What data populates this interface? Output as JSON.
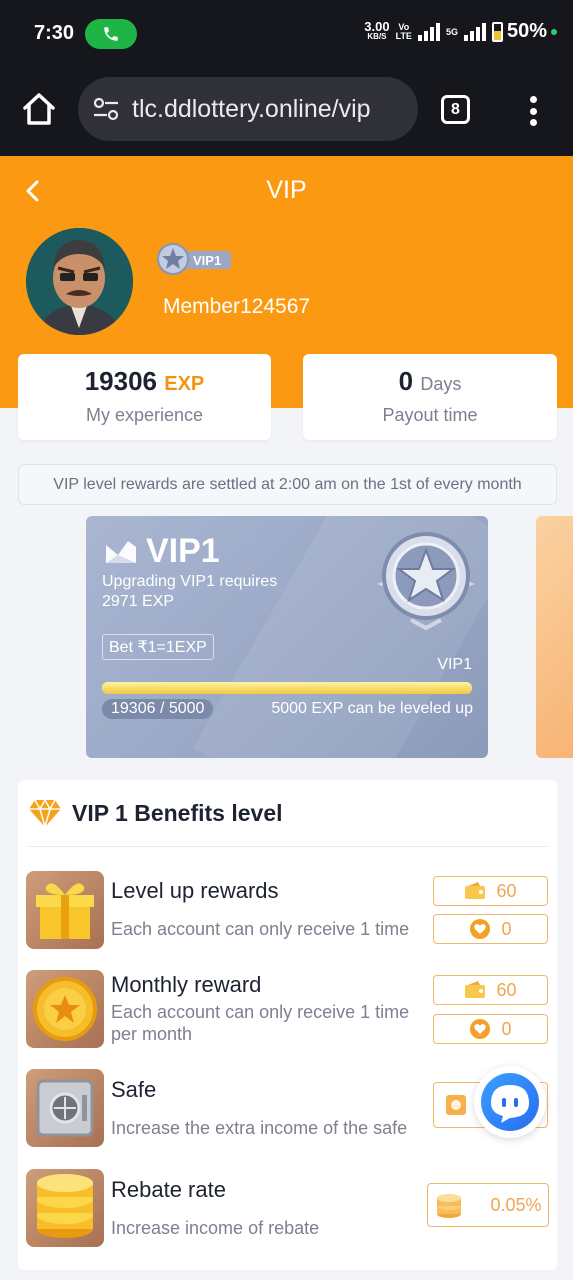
{
  "status_bar": {
    "time": "7:30",
    "net_speed": "3.00",
    "net_unit": "KB/S",
    "lte1": "Vo",
    "lte2": "LTE",
    "signal2": "5G",
    "battery": "50%"
  },
  "browser": {
    "url": "tlc.ddlottery.online/vip",
    "tab_count": "8"
  },
  "header": {
    "title": "VIP",
    "member_name": "Member124567",
    "badge_label": "VIP1"
  },
  "stats": [
    {
      "value": "19306",
      "unit": "EXP",
      "label": "My experience"
    },
    {
      "value": "0",
      "unit": "Days",
      "label": "Payout time"
    }
  ],
  "notice": "VIP level rewards are settled at 2:00 am on the 1st of every month",
  "vip_card": {
    "title": "VIP1",
    "requirement_line1": "Upgrading VIP1 requires",
    "requirement_line2": "2971 EXP",
    "bet_rule": "Bet ₹1=1EXP",
    "level_label": "VIP1",
    "progress_text": "19306 / 5000",
    "progress_fraction": 1.0,
    "leveled_text": "5000 EXP can be leveled up"
  },
  "benefits": {
    "title": "VIP 1 Benefits level",
    "items": [
      {
        "name": "Level up rewards",
        "desc": "Each account can only receive 1 time",
        "wallet": "60",
        "coin": "0"
      },
      {
        "name": "Monthly reward",
        "desc": "Each account can only receive 1 time per month",
        "wallet": "60",
        "coin": "0"
      },
      {
        "name": "Safe",
        "desc": "Increase the extra income of the safe"
      },
      {
        "name": "Rebate rate",
        "desc": "Increase income of rebate",
        "rate": "0.05%"
      }
    ]
  },
  "colors": {
    "orange": "#fb9a12",
    "card_silver": "#9aa8c6",
    "dark": "#16171c"
  }
}
